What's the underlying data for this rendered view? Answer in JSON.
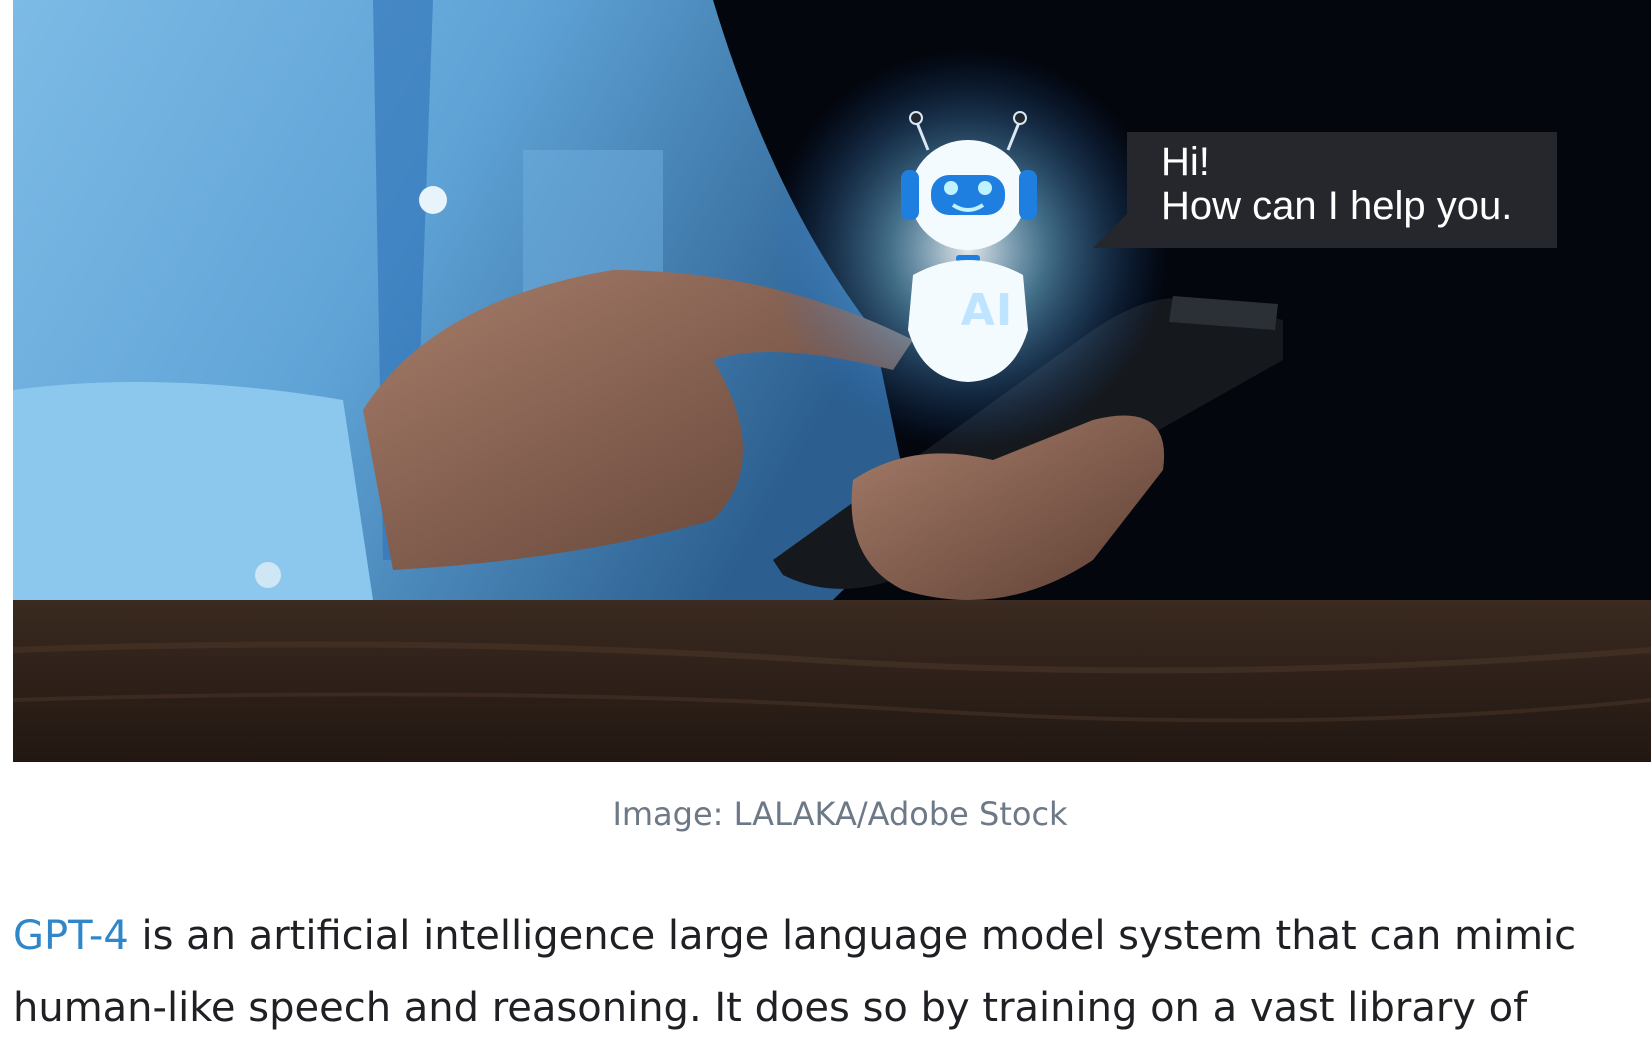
{
  "hero_image": {
    "speech_bubble": {
      "line1": "Hi!",
      "line2": "How can I help you."
    },
    "robot_badge": "AI"
  },
  "caption": "Image: LALAKA/Adobe Stock",
  "article": {
    "link_text": "GPT-4",
    "body_text": " is an artificial intelligence large language model system that can mimic human-like speech and reasoning. It does so by training on a vast library of"
  },
  "colors": {
    "link": "#2f86c9",
    "caption": "#6d7987",
    "body_text": "#1e2024"
  }
}
